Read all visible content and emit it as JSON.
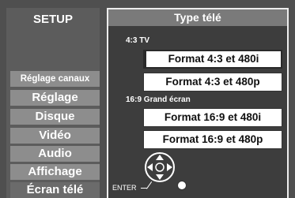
{
  "sidebar": {
    "title": "SETUP",
    "items": [
      {
        "label": "Réglage canaux"
      },
      {
        "label": "Réglage"
      },
      {
        "label": "Disque"
      },
      {
        "label": "Vidéo"
      },
      {
        "label": "Audio"
      },
      {
        "label": "Affichage"
      },
      {
        "label": "Écran télé"
      }
    ]
  },
  "panel": {
    "title": "Type télé",
    "section_43": "4:3 TV",
    "section_169": "16:9 Grand écran",
    "options": [
      {
        "label": "Format 4:3 et 480i"
      },
      {
        "label": "Format 4:3 et 480p"
      },
      {
        "label": "Format 16:9 et 480i"
      },
      {
        "label": "Format 16:9 et 480p"
      }
    ],
    "selected_option": "Format 4:3 et 480i"
  },
  "footer": {
    "enter_label": "ENTER"
  },
  "colors": {
    "background": "#4f4f4f",
    "sidebar_item": "#8d8d8d",
    "panel_background": "#3d3d3d",
    "panel_title": "#7a7a7a",
    "option_background": "#ffffff"
  },
  "icons": {
    "navigation": "dpad-icon",
    "enter": "enter-button-icon"
  }
}
